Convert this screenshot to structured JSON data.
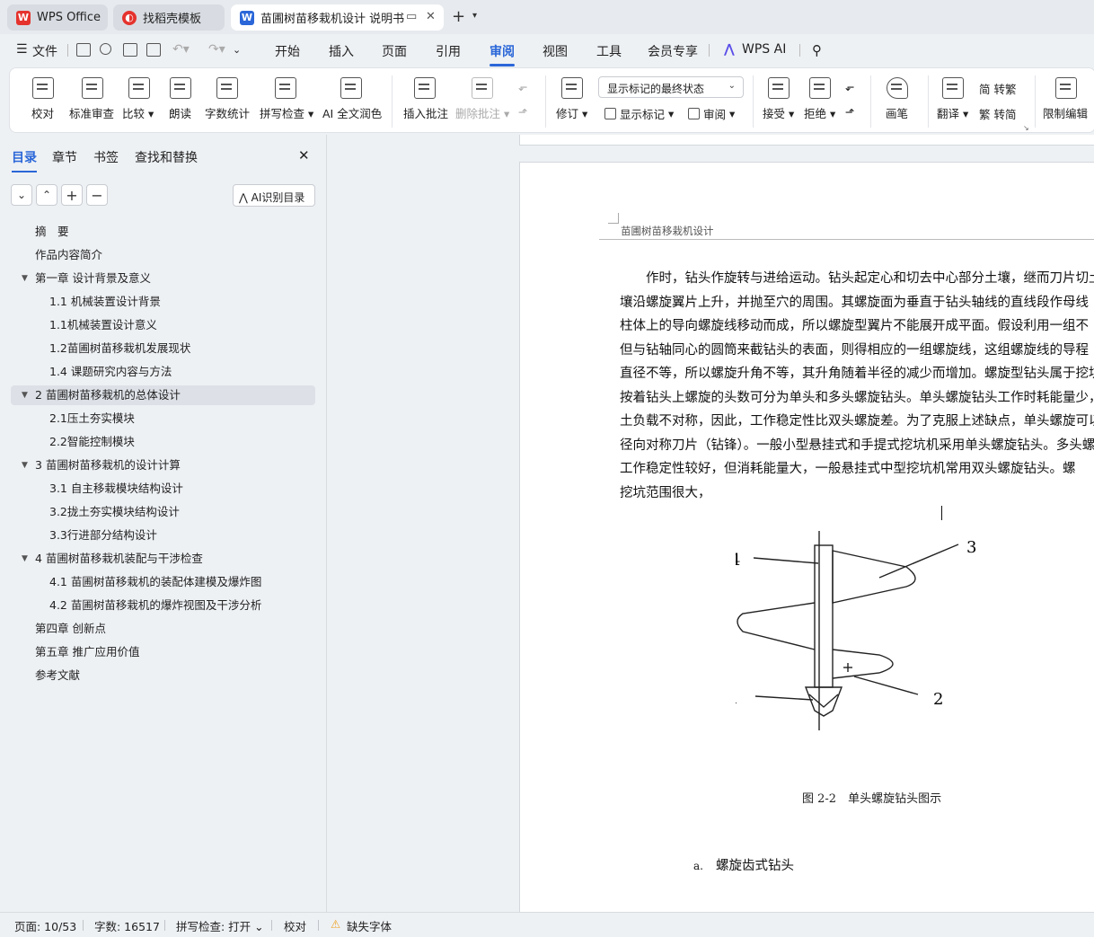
{
  "tabs": [
    {
      "label": "WPS Office",
      "icon": "wps-logo-icon",
      "color": "#e5322d"
    },
    {
      "label": "找稻壳模板",
      "icon": "docer-icon",
      "color": "#e5322d"
    },
    {
      "label": "苗圃树苗移栽机设计 说明书",
      "icon": "writer-doc-icon",
      "color": "#2a66d8"
    }
  ],
  "menu": {
    "file": "文件",
    "items": [
      "开始",
      "插入",
      "页面",
      "引用",
      "审阅",
      "视图",
      "工具",
      "会员专享",
      "WPS AI"
    ],
    "active": "审阅"
  },
  "ribbon": {
    "proofread": "校对",
    "standard_review": "标准审查",
    "compare": "比较",
    "read_aloud": "朗读",
    "word_count": "字数统计",
    "spell_check": "拼写检查",
    "ai_polish": "AI 全文润色",
    "insert_comment": "插入批注",
    "delete_comment": "删除批注",
    "revise": "修订",
    "show_markup_combo": "显示标记的最终状态",
    "show_markup": "显示标记",
    "review": "审阅",
    "accept": "接受",
    "reject": "拒绝",
    "pen": "画笔",
    "translate": "翻译",
    "to_traditional": "转繁",
    "to_simplified": "转简",
    "restrict_edit": "限制编辑",
    "simp_char": "简",
    "trad_char": "繁"
  },
  "sidebar": {
    "tabs": [
      "目录",
      "章节",
      "书签",
      "查找和替换"
    ],
    "active_tab": "目录",
    "ai_toc_label": "AI识别目录",
    "toc": [
      {
        "label": "摘　要",
        "level": 1,
        "expand": false
      },
      {
        "label": "作品内容简介",
        "level": 1,
        "expand": false
      },
      {
        "label": "第一章  设计背景及意义",
        "level": 1,
        "expand": true
      },
      {
        "label": "1.1 机械装置设计背景",
        "level": 2,
        "expand": false
      },
      {
        "label": "1.1机械装置设计意义",
        "level": 2,
        "expand": false
      },
      {
        "label": "1.2苗圃树苗移栽机发展现状",
        "level": 2,
        "expand": false
      },
      {
        "label": "1.4 课题研究内容与方法",
        "level": 2,
        "expand": false
      },
      {
        "label": "2 苗圃树苗移栽机的总体设计",
        "level": 1,
        "expand": true,
        "selected": true
      },
      {
        "label": "2.1压土夯实模块",
        "level": 2,
        "expand": false
      },
      {
        "label": "2.2智能控制模块",
        "level": 2,
        "expand": false
      },
      {
        "label": "3 苗圃树苗移栽机的设计计算",
        "level": 1,
        "expand": true
      },
      {
        "label": "3.1 自主移栽模块结构设计",
        "level": 2,
        "expand": false
      },
      {
        "label": "3.2拢土夯实模块结构设计",
        "level": 2,
        "expand": false
      },
      {
        "label": "3.3行进部分结构设计",
        "level": 2,
        "expand": false
      },
      {
        "label": "4 苗圃树苗移栽机装配与干涉检查",
        "level": 1,
        "expand": true
      },
      {
        "label": "4.1  苗圃树苗移栽机的装配体建模及爆炸图",
        "level": 2,
        "expand": false
      },
      {
        "label": "4.2 苗圃树苗移栽机的爆炸视图及干涉分析",
        "level": 2,
        "expand": false
      },
      {
        "label": "第四章  创新点",
        "level": 1,
        "expand": false
      },
      {
        "label": "第五章  推广应用价值",
        "level": 1,
        "expand": false
      },
      {
        "label": "参考文献",
        "level": 1,
        "expand": false
      }
    ]
  },
  "document": {
    "header": "苗圃树苗移栽机设计",
    "body_lines": [
      "　　作时，钻头作旋转与进给运动。钻头起定心和切去中心部分土壤，继而刀片切土、土",
      "壤沿螺旋翼片上升，并抛至穴的周围。其螺旋面为垂直于钻头轴线的直线段作母线",
      "柱体上的导向螺旋线移动而成，所以螺旋型翼片不能展开成平面。假设利用一组不",
      "但与钻轴同心的圆筒来截钻头的表面，则得相应的一组螺旋线，这组螺旋线的导程",
      "直径不等，所以螺旋升角不等，其升角随着半径的减少而增加。螺旋型钻头属于挖坑",
      "按着钻头上螺旋的头数可分为单头和多头螺旋钻头。单头螺旋钻头工作时耗能量少，",
      "土负载不对称，因此，工作稳定性比双头螺旋差。为了克服上述缺点，单头螺旋可以",
      "径向对称刀片（钻锋）。一般小型悬挂式和手提式挖坑机采用单头螺旋钻头。多头螺",
      "工作稳定性较好，但消耗能量大，一般悬挂式中型挖坑机常用双头螺旋钻头。螺",
      "挖坑范围很大，"
    ],
    "figure_labels": [
      "1",
      "2",
      "3",
      "4"
    ],
    "caption": "图  2-2　单头螺旋钻头图示",
    "subheading_marker": "a.",
    "subheading": "螺旋齿式钻头"
  },
  "status": {
    "page": "页面: 10/53",
    "words": "字数: 16517",
    "spell": "拼写检查: 打开",
    "proof": "校对",
    "missing_font": "缺失字体"
  },
  "colors": {
    "accent": "#2a66d8",
    "wps_red": "#e5322d",
    "warning": "#f0a020"
  }
}
